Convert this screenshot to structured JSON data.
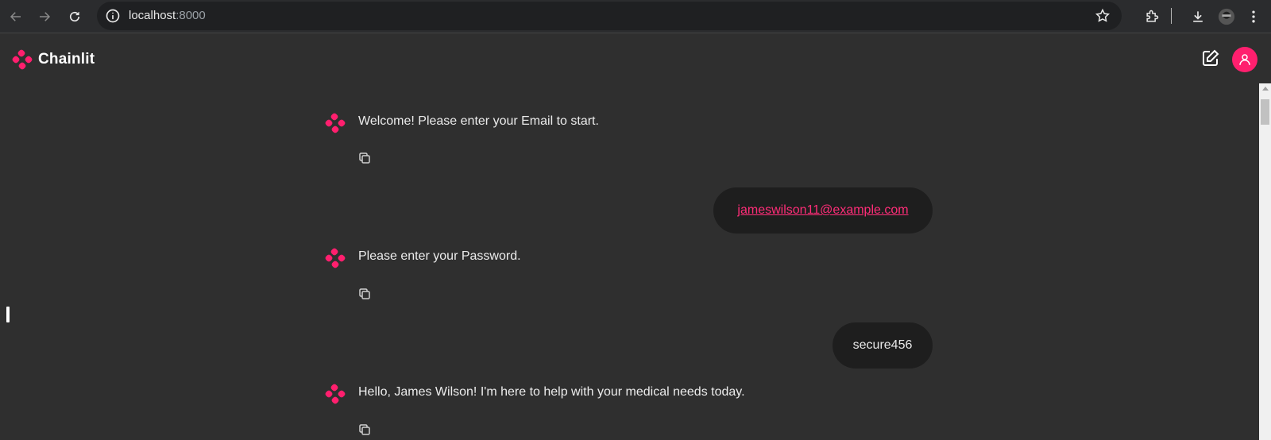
{
  "browser": {
    "url_host": "localhost",
    "url_port": ":8000"
  },
  "app": {
    "name": "Chainlit",
    "accent_color": "#ff1f6e"
  },
  "messages": [
    {
      "role": "assistant",
      "text": "Welcome! Please enter your Email to start."
    },
    {
      "role": "user",
      "text": "jameswilson11@example.com",
      "is_link": true
    },
    {
      "role": "assistant",
      "text": "Please enter your Password."
    },
    {
      "role": "user",
      "text": "secure456"
    },
    {
      "role": "assistant",
      "text": "Hello, James Wilson! I'm here to help with your medical needs today."
    }
  ],
  "icons": {
    "back": "arrow-left-icon",
    "forward": "arrow-right-icon",
    "reload": "reload-icon",
    "site_info": "info-icon",
    "bookmark": "star-icon",
    "extensions": "puzzle-icon",
    "download": "download-icon",
    "profile": "profile-avatar-icon",
    "menu": "kebab-menu-icon",
    "new_chat": "edit-icon",
    "user": "user-icon",
    "copy": "copy-icon",
    "assistant": "chainlit-logo-icon"
  }
}
